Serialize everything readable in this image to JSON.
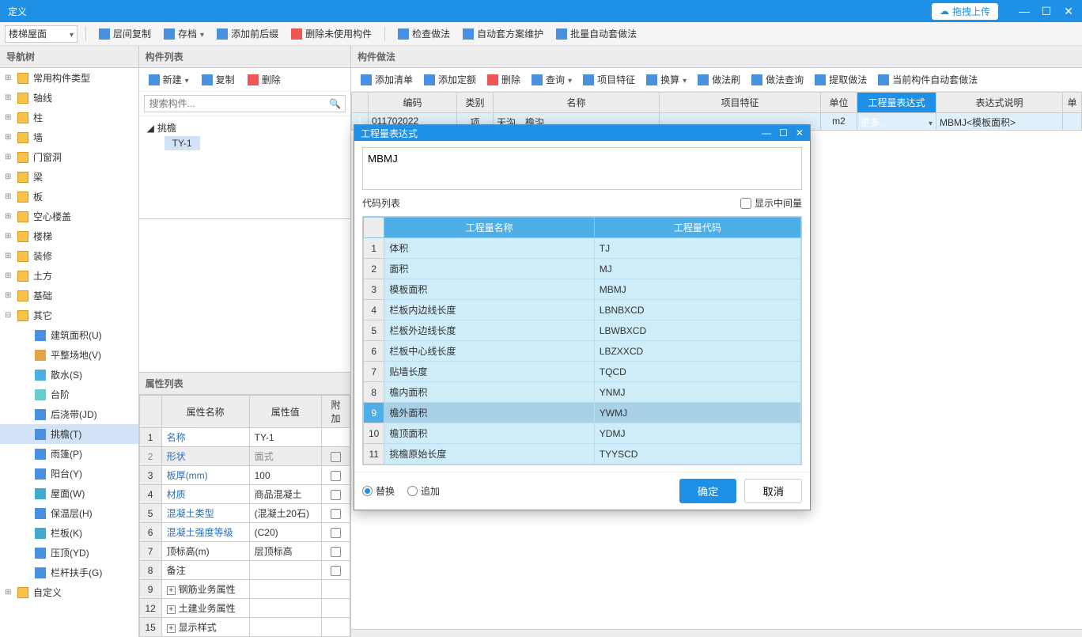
{
  "titlebar": {
    "title": "定义",
    "upload": "拖拽上传"
  },
  "toolbar": {
    "select_value": "楼梯屋面",
    "btns": [
      "层间复制",
      "存档",
      "添加前后缀",
      "删除未使用构件"
    ],
    "btns2": [
      "检查做法",
      "自动套方案维护",
      "批量自动套做法"
    ]
  },
  "nav": {
    "header": "导航树",
    "items": [
      {
        "label": "常用构件类型",
        "icon": "folder"
      },
      {
        "label": "轴线",
        "icon": "folder"
      },
      {
        "label": "柱",
        "icon": "folder"
      },
      {
        "label": "墙",
        "icon": "folder"
      },
      {
        "label": "门窗洞",
        "icon": "folder"
      },
      {
        "label": "梁",
        "icon": "folder"
      },
      {
        "label": "板",
        "icon": "folder"
      },
      {
        "label": "空心楼盖",
        "icon": "folder"
      },
      {
        "label": "楼梯",
        "icon": "folder"
      },
      {
        "label": "装修",
        "icon": "folder"
      },
      {
        "label": "土方",
        "icon": "folder"
      },
      {
        "label": "基础",
        "icon": "folder"
      },
      {
        "label": "其它",
        "icon": "folder",
        "expanded": true,
        "children": [
          {
            "label": "建筑面积(U)",
            "icon": "area"
          },
          {
            "label": "平整场地(V)",
            "icon": "level"
          },
          {
            "label": "散水(S)",
            "icon": "water"
          },
          {
            "label": "台阶",
            "icon": "step"
          },
          {
            "label": "后浇带(JD)",
            "icon": "band"
          },
          {
            "label": "挑檐(T)",
            "icon": "eaves",
            "selected": true
          },
          {
            "label": "雨篷(P)",
            "icon": "canopy"
          },
          {
            "label": "阳台(Y)",
            "icon": "balcony"
          },
          {
            "label": "屋面(W)",
            "icon": "roof"
          },
          {
            "label": "保温层(H)",
            "icon": "insul"
          },
          {
            "label": "栏板(K)",
            "icon": "rail"
          },
          {
            "label": "压顶(YD)",
            "icon": "cap"
          },
          {
            "label": "栏杆扶手(G)",
            "icon": "handrail"
          }
        ]
      },
      {
        "label": "自定义",
        "icon": "folder"
      }
    ]
  },
  "mid": {
    "header": "构件列表",
    "btns": {
      "new": "新建",
      "copy": "复制",
      "delete": "删除"
    },
    "search_placeholder": "搜索构件...",
    "tree_root": "挑檐",
    "tree_child": "TY-1"
  },
  "prop": {
    "header": "属性列表",
    "cols": {
      "name": "属性名称",
      "value": "属性值",
      "addl": "附加"
    },
    "rows": [
      {
        "n": "1",
        "name": "名称",
        "value": "TY-1",
        "link": true,
        "addl": false
      },
      {
        "n": "2",
        "name": "形状",
        "value": "面式",
        "link": true,
        "disabled": true,
        "addl": true
      },
      {
        "n": "3",
        "name": "板厚(mm)",
        "value": "100",
        "link": true,
        "addl": true
      },
      {
        "n": "4",
        "name": "材质",
        "value": "商品混凝土",
        "link": true,
        "addl": true
      },
      {
        "n": "5",
        "name": "混凝土类型",
        "value": "(混凝土20石)",
        "link": true,
        "addl": true
      },
      {
        "n": "6",
        "name": "混凝土强度等级",
        "value": "(C20)",
        "link": true,
        "addl": true
      },
      {
        "n": "7",
        "name": "顶标高(m)",
        "value": "层顶标高",
        "addl": true
      },
      {
        "n": "8",
        "name": "备注",
        "value": "",
        "addl": true
      },
      {
        "n": "9",
        "name": "钢筋业务属性",
        "value": "",
        "group": true
      },
      {
        "n": "12",
        "name": "土建业务属性",
        "value": "",
        "group": true
      },
      {
        "n": "15",
        "name": "显示样式",
        "value": "",
        "group": true
      }
    ]
  },
  "right": {
    "header": "构件做法",
    "btns": [
      "添加清单",
      "添加定额",
      "删除",
      "查询",
      "项目特征",
      "换算",
      "做法刷",
      "做法查询",
      "提取做法",
      "当前构件自动套做法"
    ],
    "grid_head": {
      "code": "编码",
      "type": "类别",
      "name": "名称",
      "feat": "项目特征",
      "unit": "单位",
      "expr": "工程量表达式",
      "desc": "表达式说明",
      "last": "单"
    },
    "row": {
      "num": "1",
      "code": "011702022",
      "type": "项",
      "name": "天沟、檐沟",
      "feat": "",
      "unit": "m2",
      "expr": "更多...",
      "desc": "MBMJ<模板面积>"
    }
  },
  "dialog": {
    "title": "工程量表达式",
    "text": "MBMJ",
    "code_label": "代码列表",
    "show_mid": "显示中间量",
    "cols": {
      "name": "工程量名称",
      "code": "工程量代码"
    },
    "rows": [
      {
        "n": "1",
        "name": "体积",
        "code": "TJ"
      },
      {
        "n": "2",
        "name": "面积",
        "code": "MJ"
      },
      {
        "n": "3",
        "name": "模板面积",
        "code": "MBMJ"
      },
      {
        "n": "4",
        "name": "栏板内边线长度",
        "code": "LBNBXCD"
      },
      {
        "n": "5",
        "name": "栏板外边线长度",
        "code": "LBWBXCD"
      },
      {
        "n": "6",
        "name": "栏板中心线长度",
        "code": "LBZXXCD"
      },
      {
        "n": "7",
        "name": "贴墙长度",
        "code": "TQCD"
      },
      {
        "n": "8",
        "name": "檐内面积",
        "code": "YNMJ"
      },
      {
        "n": "9",
        "name": "檐外面积",
        "code": "YWMJ",
        "selected": true
      },
      {
        "n": "10",
        "name": "檐顶面积",
        "code": "YDMJ"
      },
      {
        "n": "11",
        "name": "挑檐原始长度",
        "code": "TYYSCD"
      }
    ],
    "replace": "替换",
    "append": "追加",
    "ok": "确定",
    "cancel": "取消"
  }
}
